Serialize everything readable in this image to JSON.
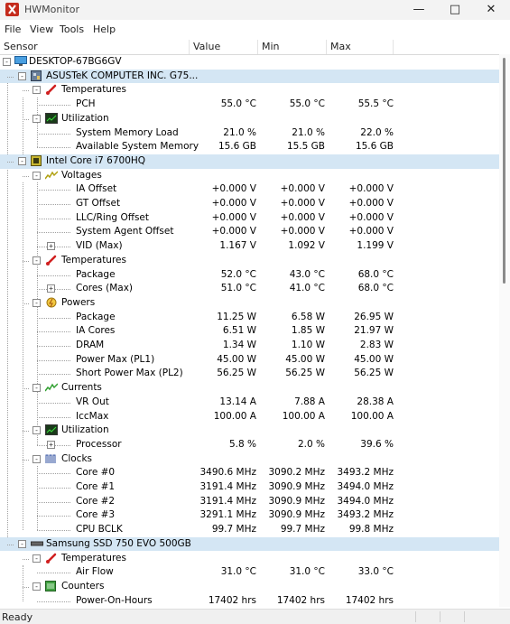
{
  "window": {
    "title": "HWMonitor"
  },
  "menu": [
    "File",
    "View",
    "Tools",
    "Help"
  ],
  "columns": [
    "Sensor",
    "Value",
    "Min",
    "Max"
  ],
  "rows": [
    {
      "level": 0,
      "label": "DESKTOP-67BG6GV",
      "icon": "monitor-icon",
      "exp": "-"
    },
    {
      "level": 1,
      "label": "ASUSTeK COMPUTER INC. G75...",
      "icon": "motherboard-icon",
      "exp": "-",
      "sel": true
    },
    {
      "level": 2,
      "label": "Temperatures",
      "icon": "thermometer-icon",
      "exp": "-"
    },
    {
      "level": 3,
      "label": "PCH",
      "value": "55.0 °C",
      "min": "55.0 °C",
      "max": "55.5 °C"
    },
    {
      "level": 2,
      "label": "Utilization",
      "icon": "utilization-icon",
      "exp": "-"
    },
    {
      "level": 3,
      "label": "System Memory Load",
      "value": "21.0 %",
      "min": "21.0 %",
      "max": "22.0 %"
    },
    {
      "level": 3,
      "label": "Available System Memory",
      "value": "15.6 GB",
      "min": "15.5 GB",
      "max": "15.6 GB"
    },
    {
      "level": 1,
      "label": "Intel Core i7 6700HQ",
      "icon": "cpu-icon",
      "exp": "-",
      "sel": true
    },
    {
      "level": 2,
      "label": "Voltages",
      "icon": "voltage-icon",
      "exp": "-"
    },
    {
      "level": 3,
      "label": "IA Offset",
      "value": "+0.000 V",
      "min": "+0.000 V",
      "max": "+0.000 V"
    },
    {
      "level": 3,
      "label": "GT Offset",
      "value": "+0.000 V",
      "min": "+0.000 V",
      "max": "+0.000 V"
    },
    {
      "level": 3,
      "label": "LLC/Ring Offset",
      "value": "+0.000 V",
      "min": "+0.000 V",
      "max": "+0.000 V"
    },
    {
      "level": 3,
      "label": "System Agent Offset",
      "value": "+0.000 V",
      "min": "+0.000 V",
      "max": "+0.000 V"
    },
    {
      "level": 3,
      "label": "VID (Max)",
      "value": "1.167 V",
      "min": "1.092 V",
      "max": "1.199 V",
      "exp": "+"
    },
    {
      "level": 2,
      "label": "Temperatures",
      "icon": "thermometer-icon",
      "exp": "-"
    },
    {
      "level": 3,
      "label": "Package",
      "value": "52.0 °C",
      "min": "43.0 °C",
      "max": "68.0 °C"
    },
    {
      "level": 3,
      "label": "Cores (Max)",
      "value": "51.0 °C",
      "min": "41.0 °C",
      "max": "68.0 °C",
      "exp": "+"
    },
    {
      "level": 2,
      "label": "Powers",
      "icon": "power-icon",
      "exp": "-"
    },
    {
      "level": 3,
      "label": "Package",
      "value": "11.25 W",
      "min": "6.58 W",
      "max": "26.95 W"
    },
    {
      "level": 3,
      "label": "IA Cores",
      "value": "6.51 W",
      "min": "1.85 W",
      "max": "21.97 W"
    },
    {
      "level": 3,
      "label": "DRAM",
      "value": "1.34 W",
      "min": "1.10 W",
      "max": "2.83 W"
    },
    {
      "level": 3,
      "label": "Power Max (PL1)",
      "value": "45.00 W",
      "min": "45.00 W",
      "max": "45.00 W"
    },
    {
      "level": 3,
      "label": "Short Power Max (PL2)",
      "value": "56.25 W",
      "min": "56.25 W",
      "max": "56.25 W"
    },
    {
      "level": 2,
      "label": "Currents",
      "icon": "current-icon",
      "exp": "-"
    },
    {
      "level": 3,
      "label": "VR Out",
      "value": "13.14 A",
      "min": "7.88 A",
      "max": "28.38 A"
    },
    {
      "level": 3,
      "label": "IccMax",
      "value": "100.00 A",
      "min": "100.00 A",
      "max": "100.00 A"
    },
    {
      "level": 2,
      "label": "Utilization",
      "icon": "utilization-icon",
      "exp": "-"
    },
    {
      "level": 3,
      "label": "Processor",
      "value": "5.8 %",
      "min": "2.0 %",
      "max": "39.6 %",
      "exp": "+"
    },
    {
      "level": 2,
      "label": "Clocks",
      "icon": "clock-icon",
      "exp": "-"
    },
    {
      "level": 3,
      "label": "Core #0",
      "value": "3490.6 MHz",
      "min": "3090.2 MHz",
      "max": "3493.2 MHz"
    },
    {
      "level": 3,
      "label": "Core #1",
      "value": "3191.4 MHz",
      "min": "3090.9 MHz",
      "max": "3494.0 MHz"
    },
    {
      "level": 3,
      "label": "Core #2",
      "value": "3191.4 MHz",
      "min": "3090.9 MHz",
      "max": "3494.0 MHz"
    },
    {
      "level": 3,
      "label": "Core #3",
      "value": "3291.1 MHz",
      "min": "3090.9 MHz",
      "max": "3493.2 MHz"
    },
    {
      "level": 3,
      "label": "CPU BCLK",
      "value": "99.7 MHz",
      "min": "99.7 MHz",
      "max": "99.8 MHz"
    },
    {
      "level": 1,
      "label": "Samsung SSD 750 EVO 500GB",
      "icon": "ssd-icon",
      "exp": "-",
      "sel": true
    },
    {
      "level": 2,
      "label": "Temperatures",
      "icon": "thermometer-icon",
      "exp": "-"
    },
    {
      "level": 3,
      "label": "Air Flow",
      "value": "31.0 °C",
      "min": "31.0 °C",
      "max": "33.0 °C"
    },
    {
      "level": 2,
      "label": "Counters",
      "icon": "counter-icon",
      "exp": "-"
    },
    {
      "level": 3,
      "label": "Power-On-Hours",
      "value": "17402 hrs",
      "min": "17402 hrs",
      "max": "17402 hrs"
    }
  ],
  "status": {
    "text": "Ready"
  }
}
